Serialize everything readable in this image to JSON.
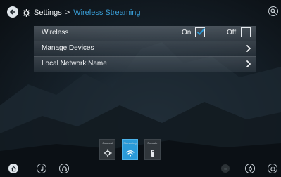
{
  "header": {
    "section": "Settings",
    "separator": ">",
    "current": "Wireless Streaming"
  },
  "settings": {
    "wireless": {
      "label": "Wireless",
      "on_label": "On",
      "off_label": "Off",
      "on_checked": true,
      "off_checked": false
    },
    "manage_devices": {
      "label": "Manage Devices"
    },
    "local_network_name": {
      "label": "Local Network Name"
    }
  },
  "tabs": [
    {
      "label": "General",
      "icon": "gear-icon",
      "active": false
    },
    {
      "label": "Streaming",
      "icon": "wifi-icon",
      "active": true
    },
    {
      "label": "Remote",
      "icon": "remote-icon",
      "active": false
    }
  ],
  "bottom_bar": {
    "left_icons": [
      "home-icon",
      "music-note-icon",
      "headphones-icon"
    ],
    "right_icons": [
      "toggle-icon",
      "gear-icon",
      "power-icon"
    ]
  },
  "colors": {
    "accent": "#2a9ad8",
    "crumb_current": "#3a9fd8",
    "text": "#f2f4f6"
  }
}
